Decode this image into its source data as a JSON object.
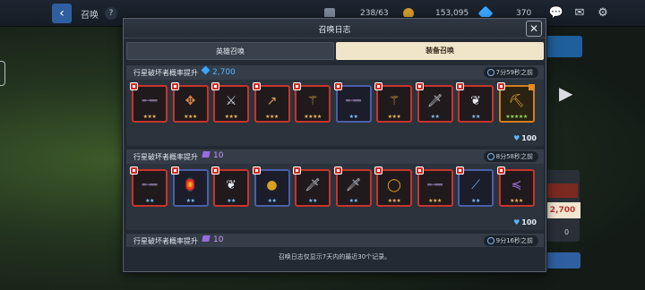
{
  "background": {
    "title": "召唤",
    "help_label": "?",
    "resources": [
      {
        "icon": "stamina-icon",
        "value": "238/63"
      },
      {
        "icon": "gold-coin-icon",
        "value": "153,095"
      },
      {
        "icon": "gem-icon",
        "value": "370"
      }
    ],
    "right_panel": {
      "price": "2,700",
      "count": "0"
    }
  },
  "modal": {
    "title": "召唤日志",
    "close_label": "✕",
    "tabs": [
      {
        "label": "英雄召唤",
        "active": false
      },
      {
        "label": "装备召唤",
        "active": true
      }
    ],
    "records": [
      {
        "title": "行星破坏者概率提升",
        "cost_type": "gem",
        "cost": "2,700",
        "time": "7分59秒之前",
        "amount": "100",
        "items": [
          {
            "icon": "rifle-icon",
            "frame": "red",
            "stars": "★★★",
            "star_color": "orange"
          },
          {
            "icon": "crossbow-icon",
            "frame": "red",
            "stars": "★★★",
            "star_color": "orange"
          },
          {
            "icon": "greatsword-icon",
            "frame": "red",
            "stars": "★★★",
            "star_color": "orange"
          },
          {
            "icon": "spear-icon",
            "frame": "red",
            "stars": "★★★",
            "star_color": "orange"
          },
          {
            "icon": "staff-icon",
            "frame": "red",
            "stars": "★★★★",
            "star_color": "orange"
          },
          {
            "icon": "rifle-icon",
            "frame": "blue",
            "stars": "★★",
            "star_color": "blue"
          },
          {
            "icon": "staff-icon",
            "frame": "red",
            "stars": "★★★",
            "star_color": "orange"
          },
          {
            "icon": "sword-icon",
            "frame": "red",
            "stars": "★★",
            "star_color": "blue"
          },
          {
            "icon": "necklace-icon",
            "frame": "red",
            "stars": "★★",
            "star_color": "blue"
          },
          {
            "icon": "pickaxe-icon",
            "frame": "legend",
            "stars": "★★★★★",
            "star_color": "green"
          }
        ]
      },
      {
        "title": "行星破坏者概率提升",
        "cost_type": "ticket",
        "cost": "10",
        "time": "8分58秒之前",
        "amount": "100",
        "items": [
          {
            "icon": "rifle-icon",
            "frame": "red",
            "stars": "★★",
            "star_color": "blue"
          },
          {
            "icon": "lantern-icon",
            "frame": "blue",
            "stars": "★★",
            "star_color": "blue"
          },
          {
            "icon": "necklace-icon",
            "frame": "red",
            "stars": "★★",
            "star_color": "blue"
          },
          {
            "icon": "bomb-icon",
            "frame": "blue",
            "stars": "★★",
            "star_color": "blue"
          },
          {
            "icon": "sword-icon",
            "frame": "red",
            "stars": "★★",
            "star_color": "blue"
          },
          {
            "icon": "sword-icon",
            "frame": "red",
            "stars": "★★",
            "star_color": "blue"
          },
          {
            "icon": "ring-icon",
            "frame": "red",
            "stars": "★★★",
            "star_color": "orange"
          },
          {
            "icon": "rifle-icon",
            "frame": "red",
            "stars": "★★★",
            "star_color": "orange"
          },
          {
            "icon": "blade-icon",
            "frame": "blue",
            "stars": "★★",
            "star_color": "blue"
          },
          {
            "icon": "dragon-gun-icon",
            "frame": "red",
            "stars": "★★★",
            "star_color": "orange"
          }
        ]
      },
      {
        "title": "行星破坏者概率提升",
        "cost_type": "ticket",
        "cost": "10",
        "time": "9分16秒之前",
        "amount": "",
        "items": []
      }
    ],
    "footer_note": "召唤日志仅显示7天内的最近30个记录。"
  }
}
